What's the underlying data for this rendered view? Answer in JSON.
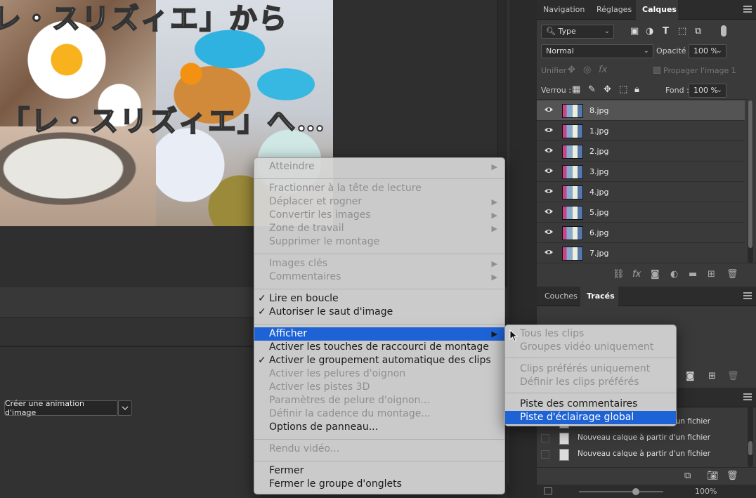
{
  "canvas": {
    "caption_line1": "レ・スリズィエ」から",
    "caption_line2": "「レ・スリズィエ」へ…"
  },
  "timeline": {
    "create_button": "Créer une animation d'image"
  },
  "panel_top": {
    "tabs": [
      "Navigation",
      "Réglages",
      "Calques"
    ],
    "filter_type": "Type",
    "blend_mode": "Normal",
    "opacity_label": "Opacité :",
    "opacity_value": "100 %",
    "unify_label": "Unifier :",
    "propagate_label": "Propager l'image 1",
    "lock_label": "Verrou :",
    "fill_label": "Fond :",
    "fill_value": "100 %",
    "layers": [
      "8.jpg",
      "1.jpg",
      "2.jpg",
      "3.jpg",
      "4.jpg",
      "5.jpg",
      "6.jpg",
      "7.jpg"
    ],
    "selected_layer": "8.jpg"
  },
  "panel_mid": {
    "tabs": [
      "Couches",
      "Tracés"
    ]
  },
  "history": {
    "rows": [
      "Nouveau calque à partir d'un fichier",
      "Nouveau calque à partir d'un fichier",
      "Nouveau calque à partir d'un fichier"
    ],
    "zoom": "100%"
  },
  "context_menu": {
    "items": [
      {
        "label": "Atteindre",
        "enabled": false,
        "submenu": true
      },
      {
        "label": "Fractionner à la tête de lecture",
        "enabled": false
      },
      {
        "label": "Déplacer et rogner",
        "enabled": false,
        "submenu": true
      },
      {
        "label": "Convertir les images",
        "enabled": false,
        "submenu": true
      },
      {
        "label": "Zone de travail",
        "enabled": false,
        "submenu": true
      },
      {
        "label": "Supprimer le montage",
        "enabled": false
      },
      {
        "label": "Images clés",
        "enabled": false,
        "submenu": true
      },
      {
        "label": "Commentaires",
        "enabled": false,
        "submenu": true
      },
      {
        "label": "Lire en boucle",
        "enabled": true,
        "checked": true
      },
      {
        "label": "Autoriser le saut d'image",
        "enabled": true,
        "checked": true
      },
      {
        "label": "Afficher",
        "enabled": true,
        "submenu": true,
        "highlighted": true
      },
      {
        "label": "Activer les touches de raccourci de montage",
        "enabled": true
      },
      {
        "label": "Activer le groupement automatique des clips",
        "enabled": true,
        "checked": true
      },
      {
        "label": "Activer les pelures d'oignon",
        "enabled": false
      },
      {
        "label": "Activer les pistes 3D",
        "enabled": false
      },
      {
        "label": "Paramètres de pelure d'oignon...",
        "enabled": false
      },
      {
        "label": "Définir la cadence du montage...",
        "enabled": false
      },
      {
        "label": "Options de panneau...",
        "enabled": true
      },
      {
        "label": "Rendu vidéo...",
        "enabled": false
      },
      {
        "label": "Fermer",
        "enabled": true
      },
      {
        "label": "Fermer le groupe d'onglets",
        "enabled": true
      }
    ]
  },
  "submenu": {
    "items": [
      {
        "label": "Tous les clips",
        "enabled": false
      },
      {
        "label": "Groupes vidéo uniquement",
        "enabled": false
      },
      {
        "label": "Clips préférés uniquement",
        "enabled": false
      },
      {
        "label": "Définir les clips préférés",
        "enabled": false
      },
      {
        "label": "Piste des commentaires",
        "enabled": true
      },
      {
        "label": "Piste d'éclairage global",
        "enabled": true,
        "highlighted": true
      }
    ]
  },
  "colors": {
    "highlight": "#1e63d6",
    "menu_bg": "#d6d6d6",
    "panel_bg": "#3a3a3a"
  }
}
